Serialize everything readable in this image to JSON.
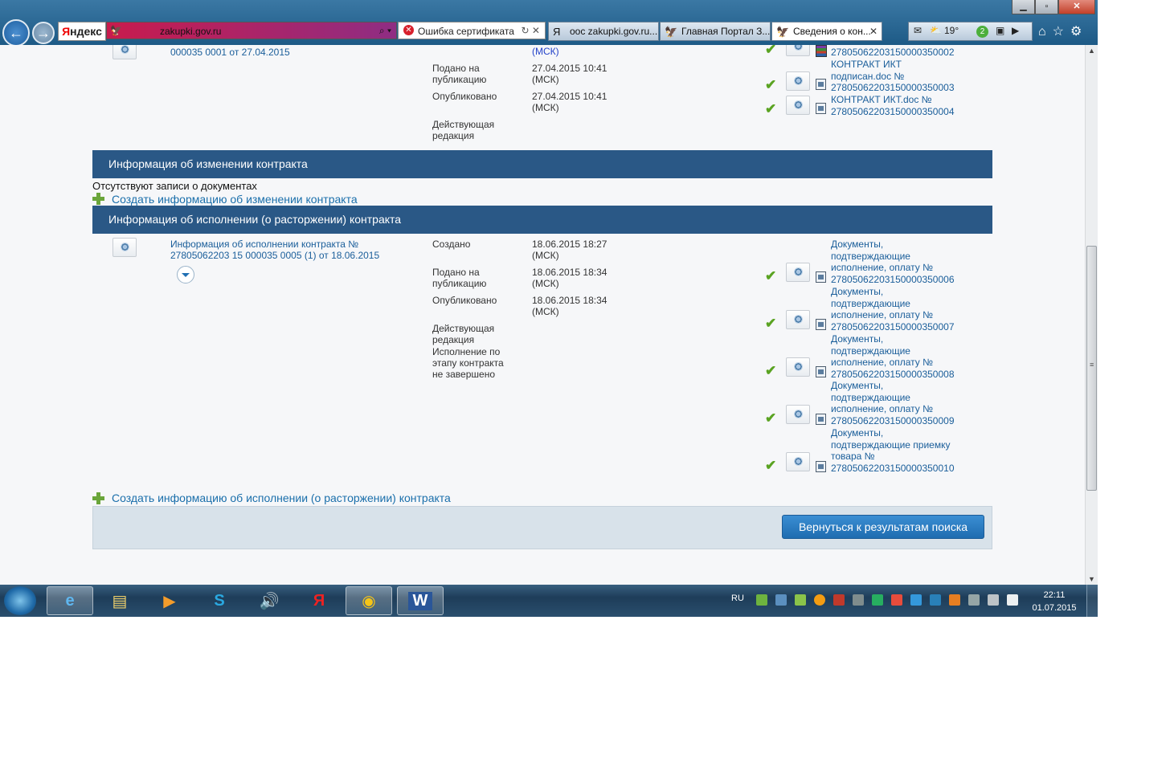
{
  "browser": {
    "yandex_label_y": "Я",
    "yandex_label_rest": "ндекс",
    "address_url": "zakupki.gov.ru",
    "cert_error": "Ошибка сертификата",
    "tabs": [
      {
        "label": "оос zakupki.gov.ru..."
      },
      {
        "label": "Главная Портал З..."
      },
      {
        "label": "Сведения о кон..."
      }
    ],
    "weather": "19°",
    "notifications_badge": "2",
    "window_buttons": {
      "minimize": "▁",
      "restore": "▫",
      "close": "✕"
    }
  },
  "top_row": {
    "title_line": "000035 0001 от 27.04.2015",
    "msk_first": "(МСК)",
    "rows": [
      {
        "label": "Подано на публикацию",
        "date": "27.04.2015 10:41",
        "tz": "(МСК)"
      },
      {
        "label": "Опубликовано",
        "date": "27.04.2015 10:41",
        "tz": "(МСК)"
      },
      {
        "label": "Действующая редакция",
        "date": "",
        "tz": ""
      }
    ],
    "docs": [
      {
        "text": "27805062203150000350002"
      },
      {
        "text": "КОНТРАКТ ИКТ подписан.doc № 27805062203150000350003"
      },
      {
        "text": "КОНТРАКТ ИКТ.doc № 27805062203150000350004"
      }
    ]
  },
  "change_section": {
    "title": "Информация об изменении контракта",
    "empty_text": "Отсутствуют записи о документах",
    "create_link": "Создать информацию об изменении контракта"
  },
  "execution_section": {
    "title": "Информация об исполнении (о расторжении) контракта",
    "record_title": "Информация об исполнении контракта № 27805062203 15 000035 0005 (1) от 18.06.2015",
    "rows": [
      {
        "label": "Создано",
        "date": "18.06.2015 18:27",
        "tz": "(МСК)"
      },
      {
        "label": "Подано на публикацию",
        "date": "18.06.2015 18:34",
        "tz": "(МСК)"
      },
      {
        "label": "Опубликовано",
        "date": "18.06.2015 18:34",
        "tz": "(МСК)"
      },
      {
        "label": "Действующая редакция",
        "date": "",
        "tz": ""
      },
      {
        "label": "Исполнение по этапу контракта не завершено",
        "date": "",
        "tz": ""
      }
    ],
    "docs": [
      {
        "text": "Документы, подтверждающие исполнение, оплату № 27805062203150000350006"
      },
      {
        "text": "Документы, подтверждающие исполнение, оплату № 27805062203150000350007"
      },
      {
        "text": "Документы, подтверждающие исполнение, оплату № 27805062203150000350008"
      },
      {
        "text": "Документы, подтверждающие исполнение, оплату № 27805062203150000350009"
      },
      {
        "text": "Документы, подтверждающие приемку товара № 27805062203150000350010"
      }
    ],
    "create_link": "Создать информацию об исполнении (о расторжении) контракта"
  },
  "footer": {
    "return_button": "Вернуться к результатам поиска"
  },
  "taskbar": {
    "lang": "RU",
    "time": "22:11",
    "date": "01.07.2015"
  },
  "colors": {
    "section_header": "#2a5886",
    "link": "#1a5e9a",
    "msk": "#2443c9",
    "check": "#5aa322",
    "button": "#1f6cb0"
  }
}
